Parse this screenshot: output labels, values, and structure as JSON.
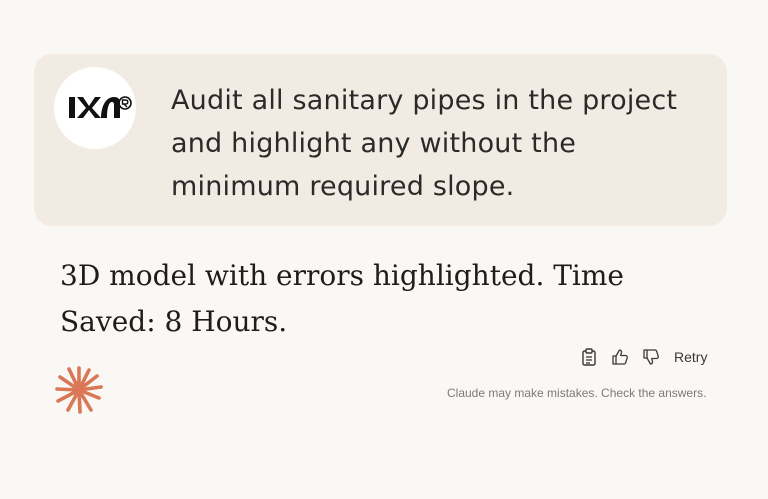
{
  "user_message": {
    "avatar_icon": "org-logo-icon",
    "text": "Audit all sanitary pipes in the project and highlight any without the minimum required slope."
  },
  "assistant_message": {
    "text": "3D model with errors highlighted. Time Saved: 8 Hours."
  },
  "actions": {
    "copy_icon": "clipboard-icon",
    "thumbs_up_icon": "thumbs-up-icon",
    "thumbs_down_icon": "thumbs-down-icon",
    "retry_label": "Retry"
  },
  "footer": {
    "logo_icon": "claude-sparkle-icon",
    "disclaimer": "Claude may make mistakes. Check the answers."
  },
  "colors": {
    "page_background": "#faf8f5",
    "user_bubble": "#f2ebe4",
    "claude_accent": "#d97757"
  }
}
